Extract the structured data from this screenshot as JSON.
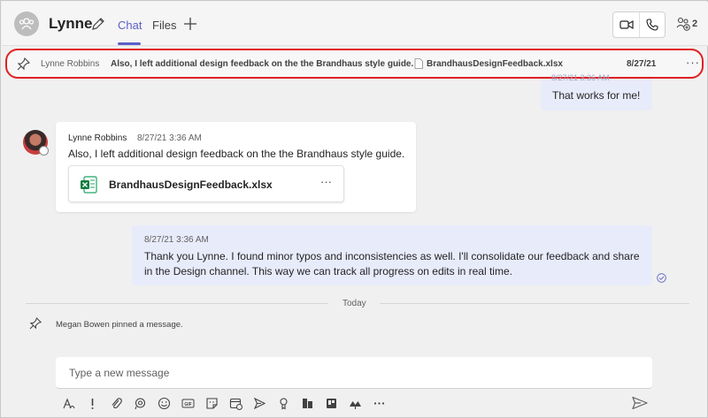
{
  "header": {
    "title": "Lynne",
    "tabs": [
      {
        "label": "Chat",
        "active": true
      },
      {
        "label": "Files",
        "active": false
      }
    ],
    "participants_count": "2",
    "accent_color": "#5b5fc7"
  },
  "pinned": {
    "sender": "Lynne Robbins",
    "text": "Also, I left additional design feedback on the the Brandhaus style guide.",
    "file": "BrandhausDesignFeedback.xlsx",
    "date": "8/27/21",
    "more_label": "···"
  },
  "messages": [
    {
      "timestamp": "8/27/21 3:36 AM",
      "text": "That works for me!"
    },
    {
      "sender": "Lynne Robbins",
      "timestamp": "8/27/21 3:36 AM",
      "text": "Also, I left additional design feedback on the the Brandhaus style guide.",
      "attachment": {
        "name": "BrandhausDesignFeedback.xlsx",
        "more_label": "···"
      }
    },
    {
      "timestamp": "8/27/21 3:36 AM",
      "text": "Thank you Lynne. I found minor typos and inconsistencies as well. I'll consolidate our feedback and share in the Design channel. This way we can track all progress on edits in real time."
    }
  ],
  "divider": {
    "label": "Today"
  },
  "system_message": {
    "text": "Megan Bowen pinned a message."
  },
  "compose": {
    "placeholder": "Type a new message"
  },
  "toolbar_icons": [
    "format-icon",
    "important-icon",
    "attach-icon",
    "loop-icon",
    "emoji-icon",
    "gif-icon",
    "sticker-icon",
    "schedule-meeting-icon",
    "stream-icon",
    "praise-icon",
    "approvals-icon",
    "updates-icon",
    "more-apps-icon",
    "more-options-icon"
  ]
}
